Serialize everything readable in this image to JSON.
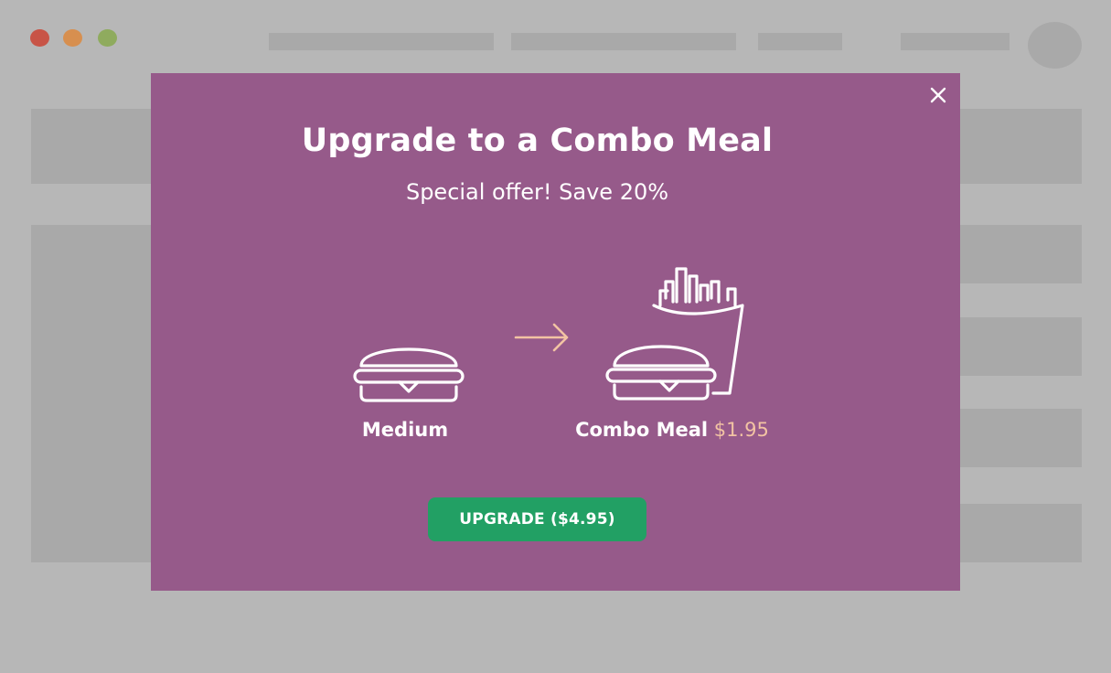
{
  "colors": {
    "backdrop": "#b7b7b7",
    "placeholder": "#a9a9a9",
    "dot_red": "#c85447",
    "dot_orange": "#d78f4f",
    "dot_green": "#8fab5e",
    "modal_bg": "#965a8a",
    "button_bg": "#22a064",
    "price_accent": "#f2c3a3",
    "arrow": "#f2c3a3"
  },
  "modal": {
    "title": "Upgrade to a Combo Meal",
    "subtitle": "Special offer! Save 20%",
    "close_icon": "close-icon",
    "from_item": {
      "icon": "burger-icon",
      "label": "Medium"
    },
    "arrow_icon": "arrow-right-icon",
    "to_item": {
      "icon": "burger-fries-icon",
      "label": "Combo Meal",
      "price": "$1.95"
    },
    "upgrade_button": "UPGRADE ($4.95)"
  }
}
